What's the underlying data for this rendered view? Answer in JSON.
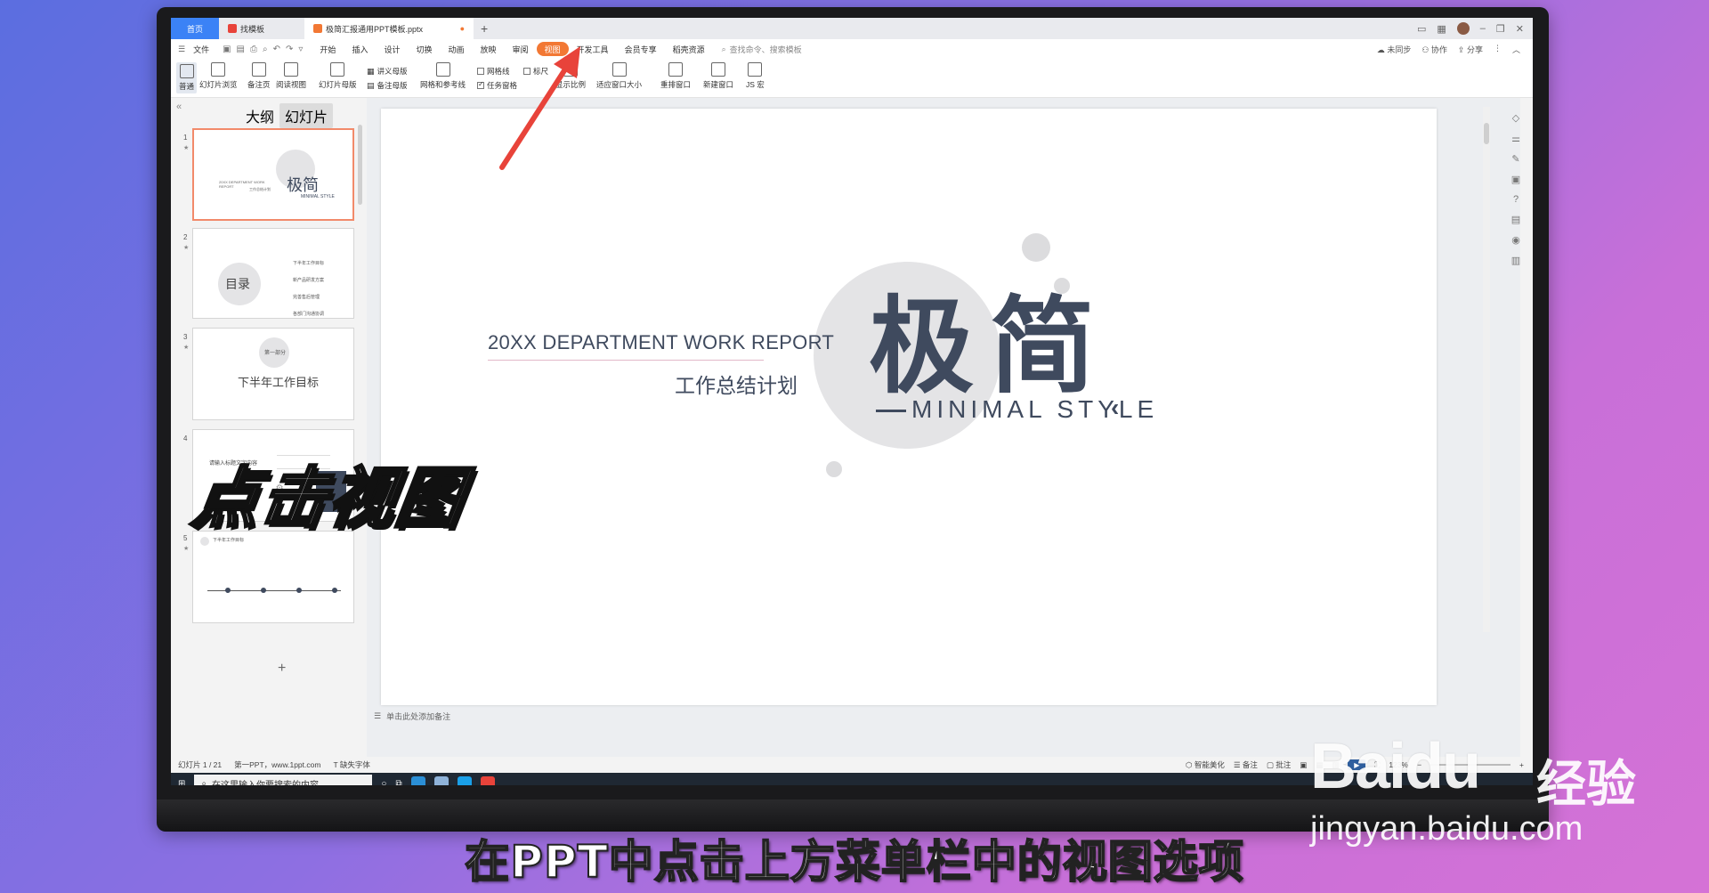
{
  "tabs": [
    {
      "label": "首页"
    },
    {
      "label": "找模板"
    },
    {
      "label": "极简汇报通用PPT模板.pptx"
    }
  ],
  "menu": {
    "file": "文件",
    "items": [
      "开始",
      "插入",
      "设计",
      "切换",
      "动画",
      "放映",
      "审阅",
      "视图",
      "开发工具",
      "会员专享",
      "稻壳资源"
    ],
    "search_placeholder": "查找命令、搜索模板",
    "right": [
      "未同步",
      "协作",
      "分享"
    ]
  },
  "ribbon": {
    "buttons": [
      "普通",
      "幻灯片浏览",
      "备注页",
      "阅读视图",
      "幻灯片母版",
      "网格和参考线",
      "显示比例",
      "适应窗口大小",
      "重排窗口",
      "新建窗口",
      "JS 宏"
    ],
    "small": [
      "讲义母版",
      "备注母版",
      "网格线",
      "标尺",
      "任务窗格"
    ]
  },
  "left_panel": {
    "tab_outline": "大纲",
    "tab_slides": "幻灯片",
    "thumbs": [
      {
        "num": "1",
        "title": "极简",
        "sub": "MINIMAL STYLE",
        "line1": "20XX DEPARTMENT WORK REPORT",
        "line2": "工作总结计划"
      },
      {
        "num": "2",
        "title": "目录",
        "items": [
          "下半年工作目标",
          "新产品研发方案",
          "完善售后管理",
          "各部门沟通协调"
        ]
      },
      {
        "num": "3",
        "title": "下半年工作目标",
        "badge": "第一部分"
      },
      {
        "num": "4",
        "title": "请输入标题文字内容"
      },
      {
        "num": "5",
        "title": "下半年工作目标"
      }
    ]
  },
  "slide": {
    "report_title": "20XX DEPARTMENT WORK REPORT",
    "report_sub": "工作总结计划",
    "big_title": "极简",
    "style_text": "MINIMAL STYLE"
  },
  "notes_placeholder": "单击此处添加备注",
  "status": {
    "slide_index": "幻灯片 1 / 21",
    "theme": "第一PPT，www.1ppt.com",
    "font_missing": "缺失字体",
    "beautify": "智能美化",
    "notes": "备注",
    "comments": "批注",
    "zoom": "123%"
  },
  "taskbar": {
    "search_placeholder": "在这里输入你要搜索的内容"
  },
  "overlay": {
    "click_text": "点击视图",
    "caption": "在PPT中点击上方菜单栏中的视图选项"
  },
  "watermark": {
    "brand": "Baidu",
    "jingyan": "经验",
    "url": "jingyan.baidu.com"
  },
  "colors": {
    "accent": "#f27834",
    "slide_dark": "#3f4a5e",
    "slide_circle": "#e4e4e6",
    "arrow": "#e8433a"
  }
}
